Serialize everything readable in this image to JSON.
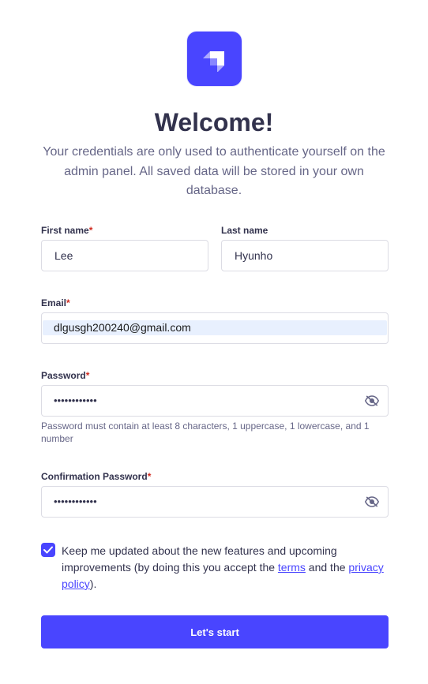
{
  "header": {
    "logo_icon": "strapi-logo-icon",
    "title": "Welcome!",
    "subtitle": "Your credentials are only used to authenticate yourself on the admin panel. All saved data will be stored in your own database."
  },
  "form": {
    "first_name": {
      "label": "First name",
      "required_mark": "*",
      "value": "Lee"
    },
    "last_name": {
      "label": "Last name",
      "value": "Hyunho"
    },
    "email": {
      "label": "Email",
      "required_mark": "*",
      "value": "dlgusgh200240@gmail.com"
    },
    "password": {
      "label": "Password",
      "required_mark": "*",
      "masked_value": "••••••••••••",
      "hint": "Password must contain at least 8 characters, 1 uppercase, 1 lowercase, and 1 number",
      "toggle_icon": "eye-off-icon"
    },
    "confirm_password": {
      "label": "Confirmation Password",
      "required_mark": "*",
      "masked_value": "••••••••••••",
      "toggle_icon": "eye-off-icon"
    },
    "news": {
      "checked": true,
      "text_before": "Keep me updated about the new features and upcoming improvements (by doing this you accept the ",
      "terms_link": "terms",
      "text_middle": " and the ",
      "privacy_link": "privacy policy",
      "text_after": ")."
    },
    "submit_label": "Let's start"
  },
  "colors": {
    "primary": "#4945ff",
    "text": "#32324d",
    "muted": "#666687",
    "required": "#d02b20",
    "border": "#dcdce4",
    "autofill": "#e8f0fe"
  }
}
